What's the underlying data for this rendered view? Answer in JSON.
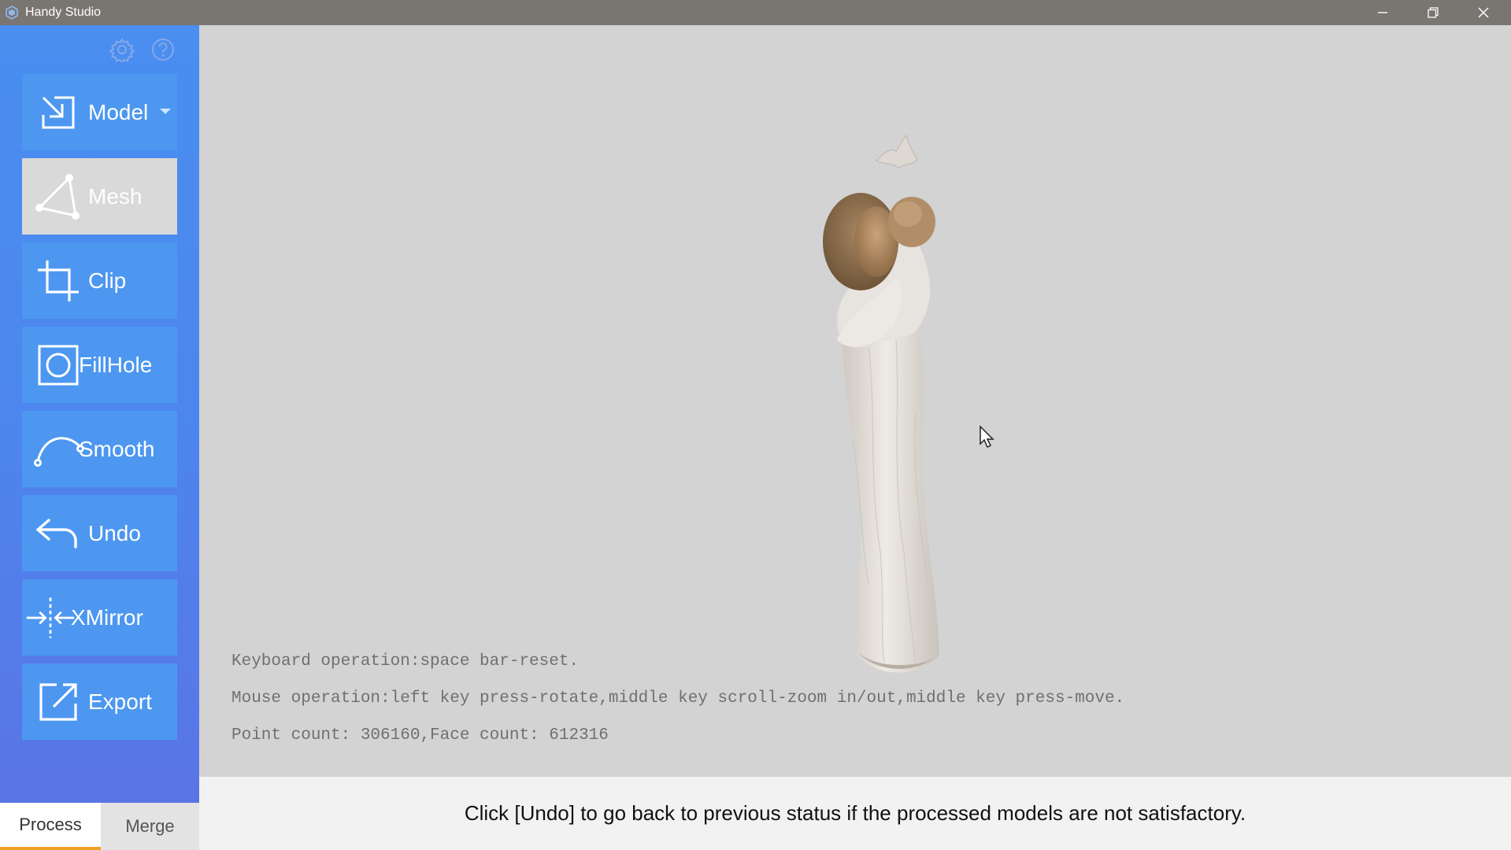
{
  "window": {
    "title": "Handy Studio"
  },
  "sidebar": {
    "tools": [
      {
        "label": "Model",
        "icon": "import-icon"
      },
      {
        "label": "Mesh",
        "icon": "triangle-mesh-icon"
      },
      {
        "label": "Clip",
        "icon": "crop-icon"
      },
      {
        "label": "FillHole",
        "icon": "fill-hole-icon"
      },
      {
        "label": "Smooth",
        "icon": "curve-icon"
      },
      {
        "label": "Undo",
        "icon": "undo-arrow-icon"
      },
      {
        "label": "XMirror",
        "icon": "mirror-icon"
      },
      {
        "label": "Export",
        "icon": "export-icon"
      }
    ],
    "active_tool": "Mesh"
  },
  "tabs": {
    "process": "Process",
    "merge": "Merge",
    "active": "Process"
  },
  "viewport": {
    "keyboard_hint": "Keyboard operation:space bar-reset.",
    "mouse_hint": "Mouse operation:left key press-rotate,middle key scroll-zoom in/out,middle key press-move.",
    "counts": "Point count: 306160,Face count: 612316"
  },
  "status": {
    "message": "Click [Undo] to go back to previous status if the processed models are not satisfactory."
  },
  "colors": {
    "sidebar_blue": "#4a8ef0",
    "active_tool_bg": "#d9d9d9",
    "tab_accent": "#f0a020"
  }
}
